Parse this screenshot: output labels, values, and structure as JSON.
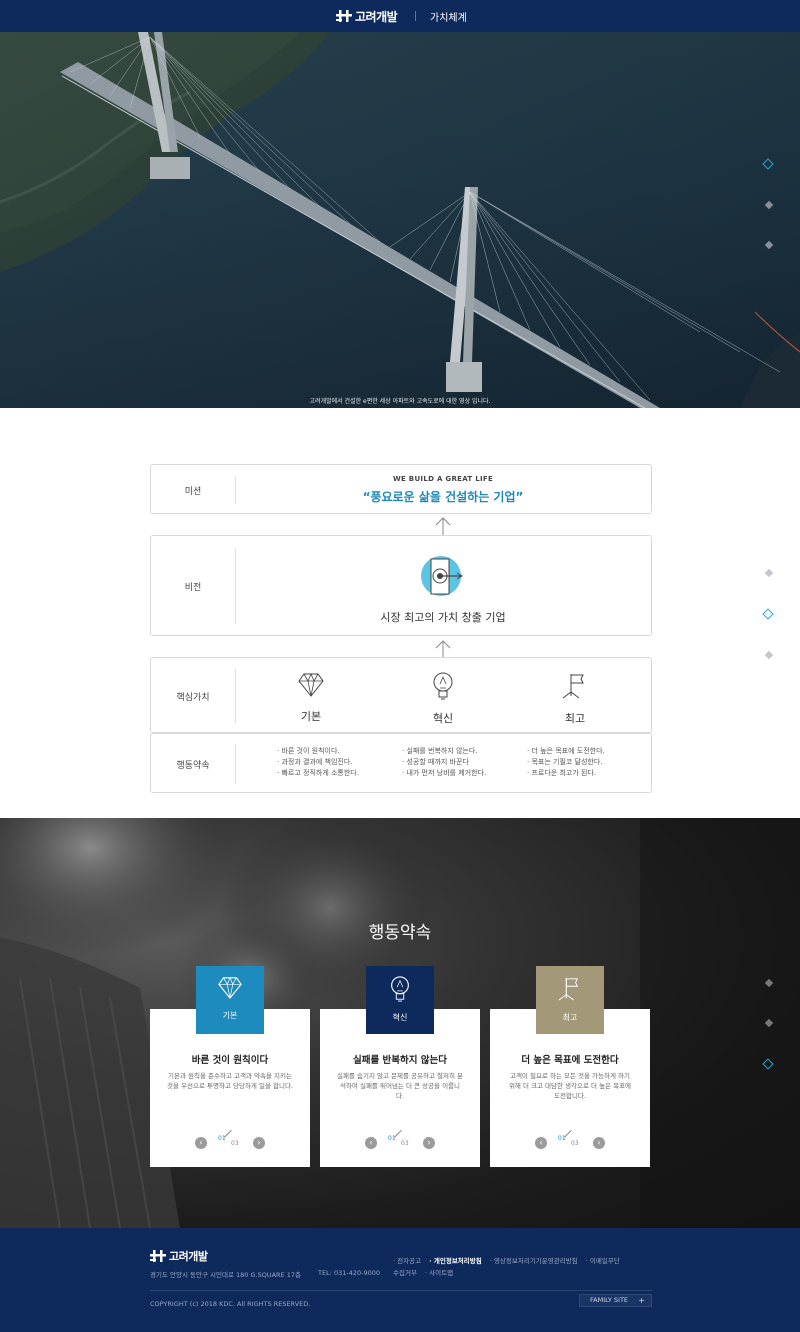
{
  "header": {
    "logo_text": "고려개발",
    "menu_label": "가치체계"
  },
  "hero": {
    "caption": "고려개발에서 건설한 e편한 세상 아파트와 고속도로에 대한 영상 입니다."
  },
  "value_system": {
    "mission": {
      "label": "미션",
      "subtitle": "WE BUILD A GREAT LIFE",
      "title": "“풍요로운 삶을 건설하는 기업”"
    },
    "vision": {
      "label": "비전",
      "title": "시장 최고의 가치 창출 기업"
    },
    "core_values": {
      "label": "핵심가치",
      "items": [
        {
          "label": "기본",
          "icon": "diamond-icon"
        },
        {
          "label": "혁신",
          "icon": "lightbulb-icon"
        },
        {
          "label": "최고",
          "icon": "flag-icon"
        }
      ]
    },
    "pledge": {
      "label": "행동약속",
      "columns": [
        [
          "바른 것이 원칙이다.",
          "과정과 결과에 책임진다.",
          "빠르고 정직하게 소통한다."
        ],
        [
          "실패를 번복하지 않는다.",
          "성공할 때까지 바꾼다",
          "내가 먼저 낭비를 제거한다."
        ],
        [
          "더 높은 목표에 도전한다.",
          "목표는 기필코 달성한다.",
          "프로다운 최고가 된다."
        ]
      ]
    }
  },
  "pledge_section": {
    "title": "행동약속",
    "cards": [
      {
        "tab": "기본",
        "tab_color": "#1d8bbd",
        "icon": "diamond-icon",
        "heading": "바른 것이 원칙이다",
        "body": "기본과 원칙을 준수하고 고객과 약속을 지키는 것을 우선으로 투명하고 당당하게 일을 합니다.",
        "current": "01",
        "total": "03"
      },
      {
        "tab": "혁신",
        "tab_color": "#0e2a5c",
        "icon": "lightbulb-icon",
        "heading": "실패를 반복하지 않는다",
        "body": "실패를 숨기지 않고 문제를 공유하고 철저히 분석하여 실패를 뛰어넘는 더 큰 성공을 이룹니다.",
        "current": "01",
        "total": "03"
      },
      {
        "tab": "최고",
        "tab_color": "#a39978",
        "icon": "flag-icon",
        "heading": "더 높은 목표에 도전한다",
        "body": "고객이 필요로 하는 모든 것을 가능하게 하기 위해 더 크고 대담한 생각으로 더 높은 목표에 도전합니다.",
        "current": "01",
        "total": "03"
      }
    ]
  },
  "footer": {
    "logo_text": "고려개발",
    "address": "경기도 안양시 동안구 시민대로 180 G.SQUARE 17층",
    "tel": "TEL: 031-420-9000",
    "links": [
      "전자공고",
      "개인정보처리방침",
      "영상정보처리기기운영관리방침",
      "이메일무단수집거부",
      "사이트맵"
    ],
    "copyright": "COPYRIGHT (c) 2018 KDC. All RIGHTS RESERVED.",
    "family_site": "FAMILY SITE"
  },
  "colors": {
    "navy": "#0e2a5c",
    "accent_blue": "#1d89b8",
    "gold": "#a39978"
  }
}
